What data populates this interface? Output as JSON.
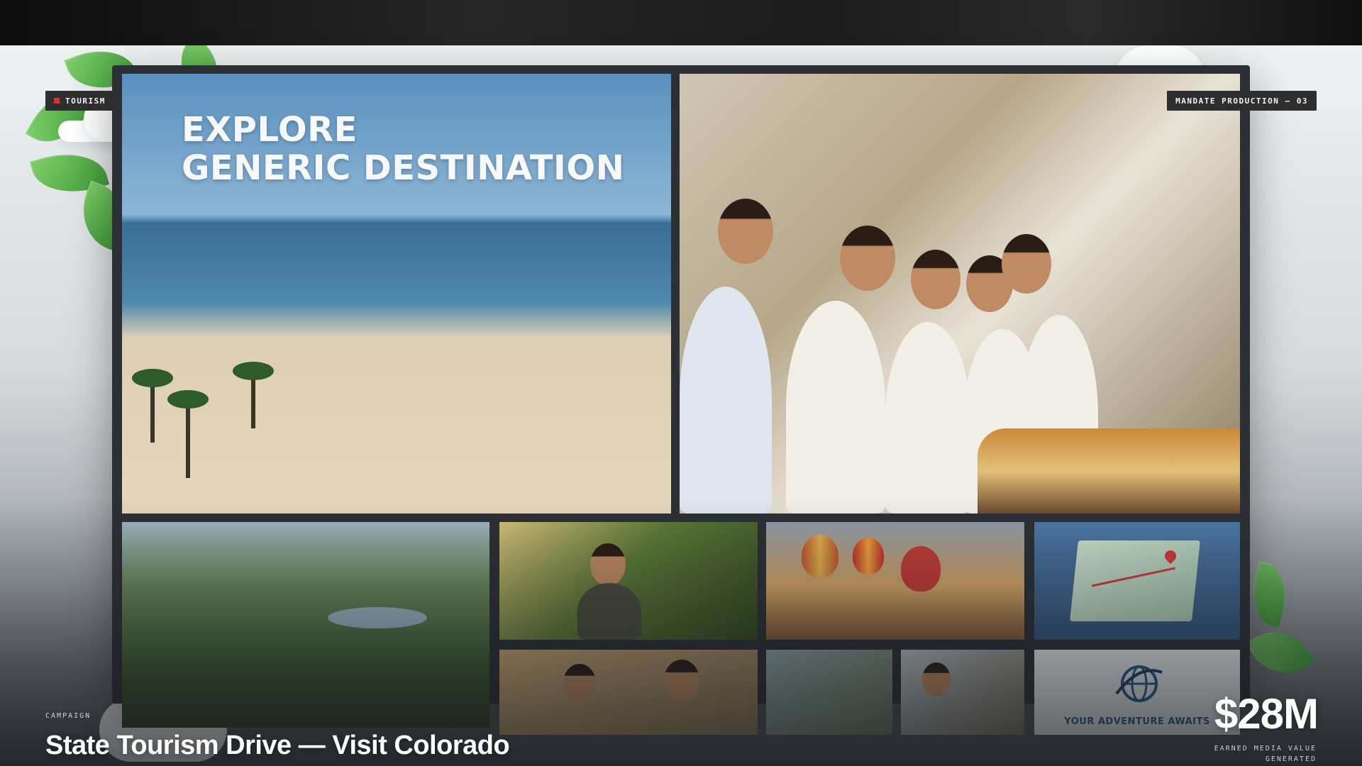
{
  "badges": {
    "category": "TOURISM",
    "production": "MANDATE PRODUCTION — 03"
  },
  "hero": {
    "headline_line1": "EXPLORE",
    "headline_line2": "GENERIC DESTINATION"
  },
  "tiles": {
    "adventure_text": "YOUR ADVENTURE AWAITS"
  },
  "caption": {
    "label": "CAMPAIGN",
    "title": "State Tourism Drive — Visit Colorado"
  },
  "metric": {
    "value": "$28M",
    "label": "EARNED MEDIA VALUE GENERATED"
  },
  "colors": {
    "badge_bg": "#2e2e2e",
    "badge_dot": "#d8302b",
    "leaf_green": "#4caf50",
    "accent_blue": "#2a5a86"
  }
}
